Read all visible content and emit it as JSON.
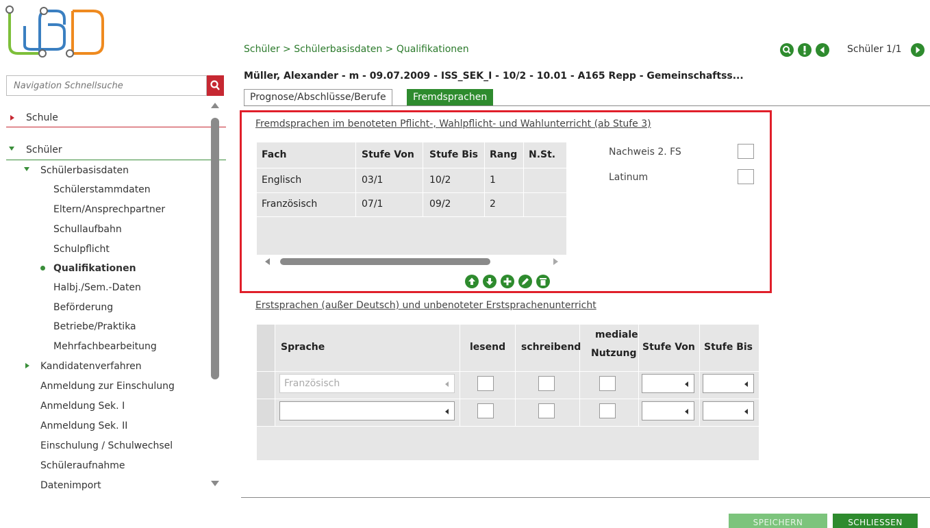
{
  "colors": {
    "accent_green": "#2e8b2e",
    "accent_red": "#c62832",
    "highlight_red": "#e01f2a"
  },
  "sidebar": {
    "search_placeholder": "Navigation Schnellsuche",
    "items": [
      "Schule",
      "Schüler",
      "Schülerbasisdaten",
      "Schülerstammdaten",
      "Eltern/Ansprechpartner",
      "Schullaufbahn",
      "Schulpflicht",
      "Qualifikationen",
      "Halbj./Sem.-Daten",
      "Beförderung",
      "Betriebe/Praktika",
      "Mehrfachbearbeitung",
      "Kandidatenverfahren",
      "Anmeldung zur Einschulung",
      "Anmeldung Sek. I",
      "Anmeldung Sek. II",
      "Einschulung / Schulwechsel",
      "Schüleraufnahme",
      "Datenimport"
    ]
  },
  "header": {
    "breadcrumb": "Schüler > Schülerbasisdaten > Qualifikationen",
    "pupil": "Müller, Alexander - m - 09.07.2009 - ISS_SEK_I - 10/2 - 10.01 - A165 Repp - Gemeinschaftss...",
    "counter": "Schüler 1/1"
  },
  "tabs": [
    "Prognose/Abschlüsse/Berufe",
    "Fremdsprachen"
  ],
  "fremdsprachen": {
    "title": "Fremdsprachen im benoteten Pflicht-, Wahlpflicht- und Wahlunterricht (ab Stufe 3)",
    "columns": [
      "Fach",
      "Stufe Von",
      "Stufe Bis",
      "Rang",
      "N.St."
    ],
    "rows": [
      [
        "Englisch",
        "03/1",
        "10/2",
        "1",
        ""
      ],
      [
        "Französisch",
        "07/1",
        "09/2",
        "2",
        ""
      ]
    ],
    "checkboxes": [
      "Nachweis 2. FS",
      "Latinum"
    ]
  },
  "erstsprachen": {
    "title": "Erstsprachen (außer Deutsch) und unbenoteter Erstsprachenunterricht",
    "columns": [
      "Sprache",
      "lesend",
      "schreibend",
      "mediale",
      "Nutzung",
      "Stufe Von",
      "Stufe Bis"
    ],
    "row1_language_placeholder": "Französisch"
  },
  "buttons": {
    "save": "SPEICHERN",
    "close": "SCHLIESSEN"
  }
}
